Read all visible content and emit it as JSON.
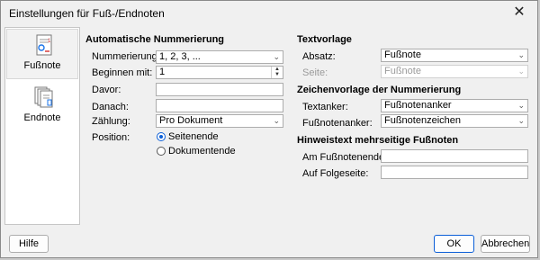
{
  "window": {
    "title": "Einstellungen für Fuß-/Endnoten",
    "close_icon": "close-icon"
  },
  "sidebar": {
    "items": [
      {
        "label": "Fußnote",
        "icon": "footnote-icon",
        "selected": true
      },
      {
        "label": "Endnote",
        "icon": "endnote-icon",
        "selected": false
      }
    ]
  },
  "numbering": {
    "heading": "Automatische Nummerierung",
    "nummerierung_label": "Nummerierung:",
    "nummerierung_value": "1, 2, 3, ...",
    "beginnen_label": "Beginnen mit:",
    "beginnen_value": "1",
    "davor_label": "Davor:",
    "davor_value": "",
    "danach_label": "Danach:",
    "danach_value": "",
    "zaehlung_label": "Zählung:",
    "zaehlung_value": "Pro Dokument",
    "position_label": "Position:",
    "position_options": [
      "Seitenende",
      "Dokumentende"
    ],
    "position_selected": "Seitenende"
  },
  "textvorlage": {
    "heading": "Textvorlage",
    "absatz_label": "Absatz:",
    "absatz_value": "Fußnote",
    "seite_label": "Seite:",
    "seite_value": "Fußnote"
  },
  "zeichenvorlage": {
    "heading": "Zeichenvorlage der Nummerierung",
    "textanker_label": "Textanker:",
    "textanker_value": "Fußnotenanker",
    "fussnotenanker_label": "Fußnotenanker:",
    "fussnotenanker_value": "Fußnotenzeichen"
  },
  "hinweistext": {
    "heading": "Hinweistext mehrseitige Fußnoten",
    "am_ende_label": "Am Fußnotenende:",
    "am_ende_value": "",
    "folgeseite_label": "Auf Folgeseite:",
    "folgeseite_value": ""
  },
  "buttons": {
    "help": "Hilfe",
    "ok": "OK",
    "cancel": "Abbrechen"
  },
  "colors": {
    "accent": "#0b5ed7",
    "background": "#f0f0f0"
  }
}
